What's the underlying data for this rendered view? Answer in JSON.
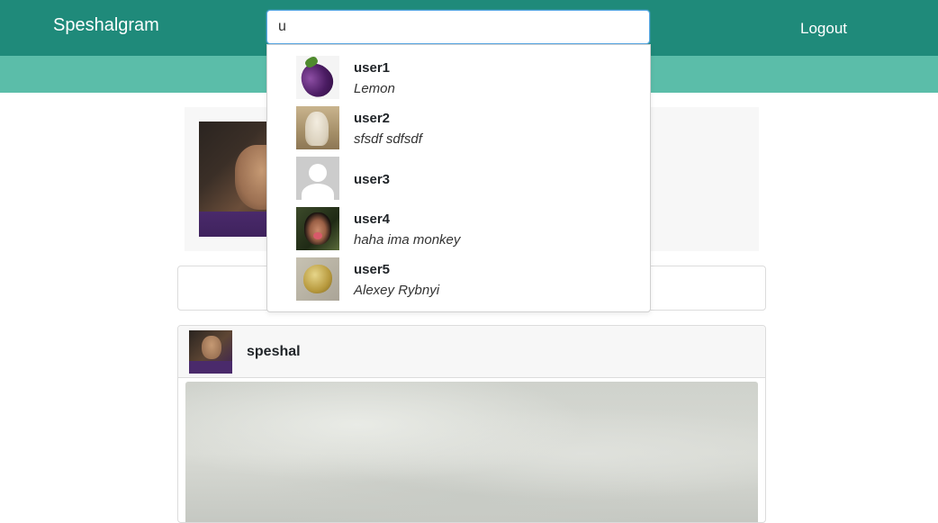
{
  "app": {
    "brand": "Speshalgram",
    "logout_label": "Logout"
  },
  "search": {
    "value": "u",
    "results": [
      {
        "username": "user1",
        "bio": "Lemon",
        "avatar_icon": "eggplant-avatar"
      },
      {
        "username": "user2",
        "bio": "sfsdf sdfsdf",
        "avatar_icon": "dog-avatar"
      },
      {
        "username": "user3",
        "bio": "",
        "avatar_icon": "default-avatar"
      },
      {
        "username": "user4",
        "bio": "haha ima monkey",
        "avatar_icon": "monkey-avatar"
      },
      {
        "username": "user5",
        "bio": "Alexey Rybnyi",
        "avatar_icon": "potato-avatar"
      }
    ]
  },
  "post": {
    "username": "speshal"
  },
  "colors": {
    "navbar": "#1f8a7a",
    "subbar": "#5bbda9"
  }
}
